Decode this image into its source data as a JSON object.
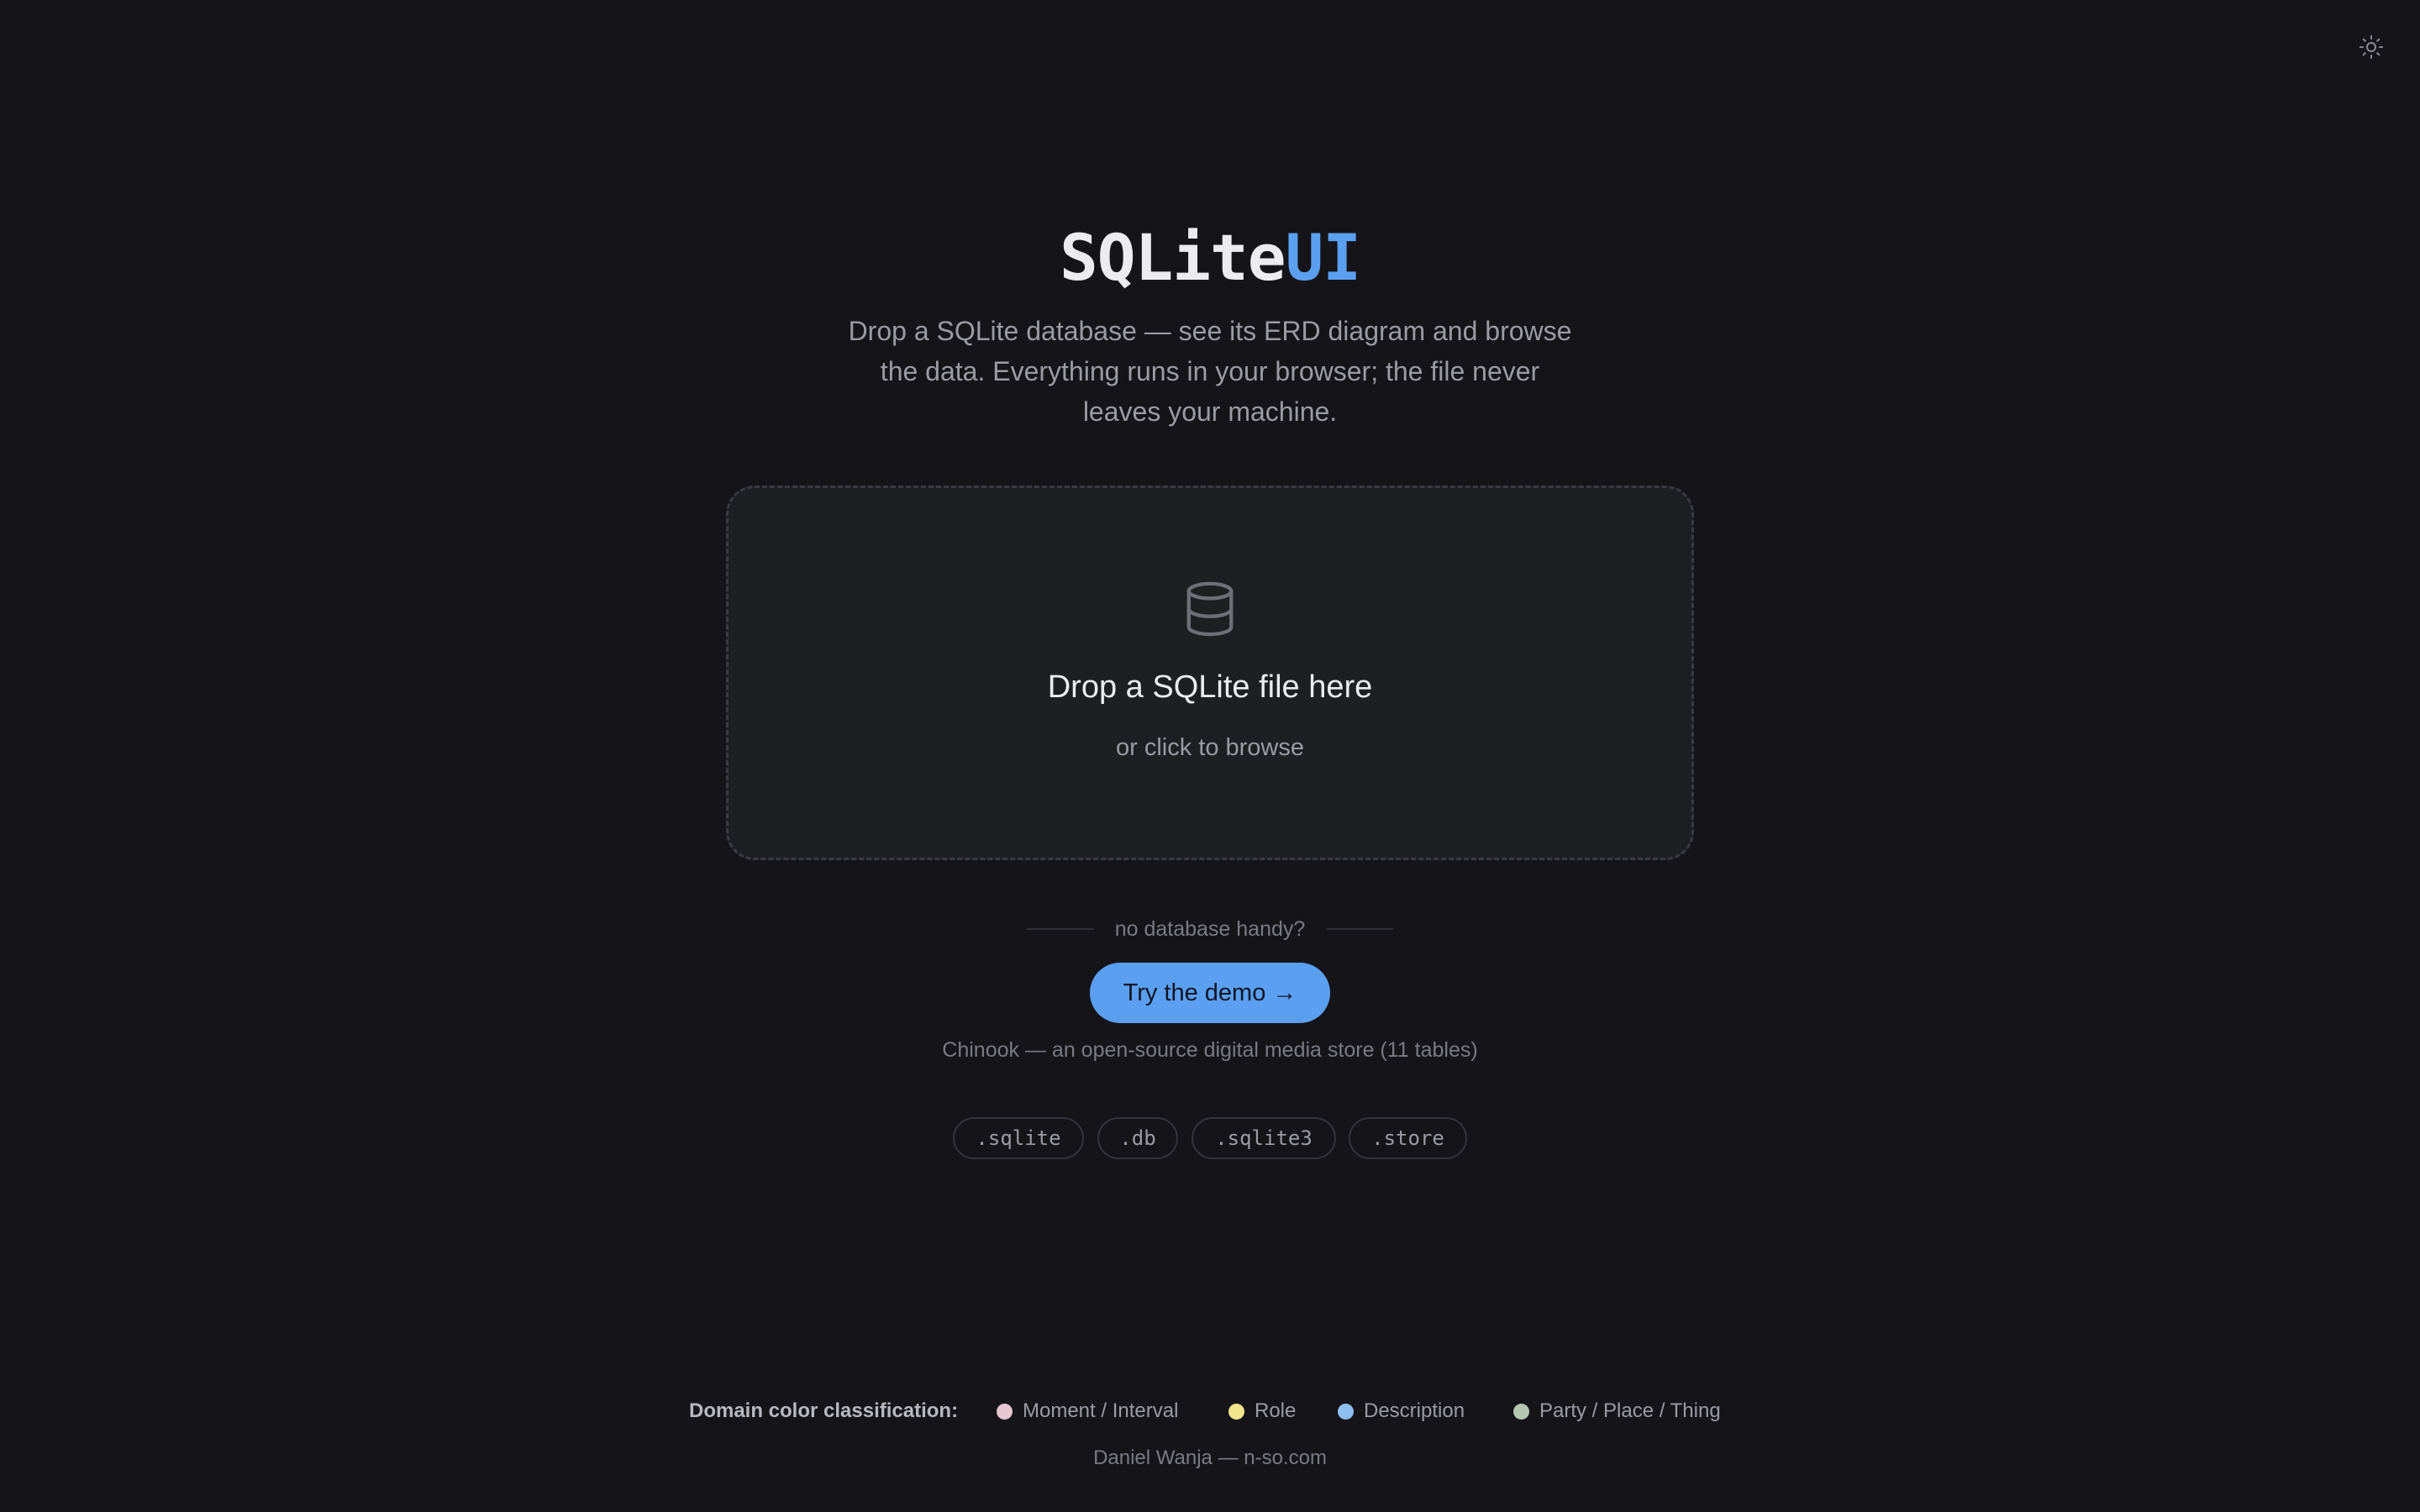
{
  "header": {
    "theme_toggle_icon": "sun-icon"
  },
  "hero": {
    "title_part1": "SQLite",
    "title_part2": "UI",
    "title_accent_color": "#5b9ff0",
    "subtitle": "Drop a SQLite database — see its ERD diagram and browse the data. Everything runs in your browser; the file never leaves your machine."
  },
  "dropzone": {
    "icon": "database-icon",
    "title": "Drop a SQLite file here",
    "subtitle": "or click to browse"
  },
  "demo": {
    "divider_text": "no database handy?",
    "button_label": "Try the demo →",
    "button_color": "#5b9ff0",
    "note": "Chinook — an open-source digital media store (11 tables)"
  },
  "extensions": [
    ".sqlite",
    ".db",
    ".sqlite3",
    ".store"
  ],
  "legend": {
    "title": "Domain color classification:",
    "items": [
      {
        "label": "Moment / Interval",
        "color": "#e6c6d0"
      },
      {
        "label": "Role",
        "color": "#f3e58e"
      },
      {
        "label": "Description",
        "color": "#8fbff0"
      },
      {
        "label": "Party / Place / Thing",
        "color": "#b5c7b0"
      }
    ]
  },
  "footer": {
    "credit": "Daniel Wanja — n-so.com"
  }
}
